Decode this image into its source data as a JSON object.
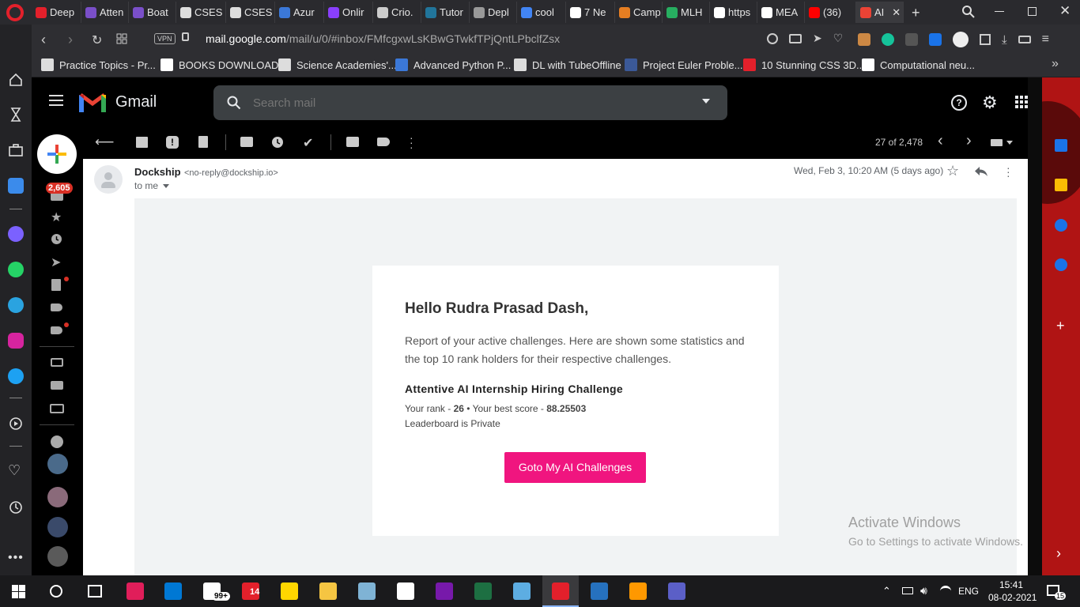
{
  "browser": {
    "tabs": [
      {
        "label": "Deep",
        "color": "#e3202b"
      },
      {
        "label": "Atten",
        "color": "#7a4fc9"
      },
      {
        "label": "Boat",
        "color": "#7a4fc9"
      },
      {
        "label": "CSES",
        "color": "#dddddd"
      },
      {
        "label": "CSES",
        "color": "#dddddd"
      },
      {
        "label": "Azur",
        "color": "#3b78d8"
      },
      {
        "label": "Onlir",
        "color": "#8a3ffc"
      },
      {
        "label": "Crio.",
        "color": "#cccccc"
      },
      {
        "label": "Tutor",
        "color": "#21759b"
      },
      {
        "label": "Depl",
        "color": "#999999"
      },
      {
        "label": "cool",
        "color": "#4285f4"
      },
      {
        "label": "7 Ne",
        "color": "#ffffff"
      },
      {
        "label": "Camp",
        "color": "#e67e22"
      },
      {
        "label": "MLH",
        "color": "#27ae60"
      },
      {
        "label": "https",
        "color": "#ffffff"
      },
      {
        "label": "MEA",
        "color": "#ffffff"
      },
      {
        "label": "(36)",
        "color": "#ff0000"
      },
      {
        "label": "AI",
        "color": "#ea4335"
      }
    ],
    "address": {
      "domain": "mail.google.com",
      "path": "/mail/u/0/#inbox/FMfcgxwLsKBwGTwkfTPjQntLPbclfZsx",
      "vpn": "VPN"
    },
    "bookmarks": [
      {
        "label": "Practice Topics - Pr...",
        "color": "#dddddd"
      },
      {
        "label": "BOOKS DOWNLOAD",
        "color": "#ffffff"
      },
      {
        "label": "Science Academies'...",
        "color": "#dddddd"
      },
      {
        "label": "Advanced Python P...",
        "color": "#3b78d8"
      },
      {
        "label": "DL with TubeOffline",
        "color": "#dddddd"
      },
      {
        "label": "Project Euler Proble...",
        "color": "#3b5998"
      },
      {
        "label": "10 Stunning CSS 3D...",
        "color": "#e3202b"
      },
      {
        "label": "Computational neu...",
        "color": "#ffffff"
      }
    ]
  },
  "gmail": {
    "logo_text": "Gmail",
    "search_placeholder": "Search mail",
    "inbox_badge": "2,605",
    "pagination": "27 of 2,478"
  },
  "email": {
    "sender_name": "Dockship",
    "sender_email": "<no-reply@dockship.io>",
    "to": "to me",
    "date": "Wed, Feb 3, 10:20 AM (5 days ago)",
    "greeting": "Hello Rudra Prasad Dash,",
    "intro": "Report of your active challenges. Here are shown some statistics and the top 10 rank holders for their respective challenges.",
    "challenge_title": "Attentive AI Internship Hiring Challenge",
    "rank_label": "Your rank - ",
    "rank_value": "26",
    "score_label": " • Your best score - ",
    "score_value": "88.25503",
    "leaderboard": "Leaderboard is Private",
    "cta": "Goto My AI Challenges"
  },
  "watermark": {
    "title": "Activate Windows",
    "subtitle": "Go to Settings to activate Windows."
  },
  "taskbar": {
    "badge_count": "99+",
    "calendar_count": "14",
    "language": "ENG",
    "time": "15:41",
    "date": "08-02-2021",
    "notif_count": "15"
  },
  "colors": {
    "cta": "#f0157f",
    "gmail_dark": "#000000",
    "content_bg": "#f1f3f4",
    "badge_red": "#d93025"
  }
}
